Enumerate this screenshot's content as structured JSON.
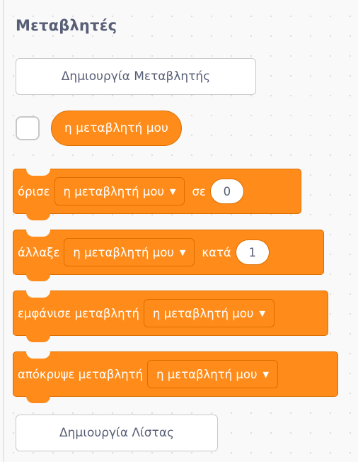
{
  "category": {
    "title": "Μεταβλητές",
    "color": "#ff8c1a",
    "border_color": "#db6e00",
    "text_color": "#575e75"
  },
  "make_variable_button": {
    "label": "Δημιουργία Μεταβλητής"
  },
  "variable_reporter": {
    "checked": false,
    "label": "η μεταβλητή μου"
  },
  "blocks": {
    "set": {
      "label": "όρισε",
      "variable": "η μεταβλητή μου",
      "dropdown_icon": "caret-down-icon",
      "connector": "σε",
      "value": "0"
    },
    "change": {
      "label": "άλλαξε",
      "variable": "η μεταβλητή μου",
      "dropdown_icon": "caret-down-icon",
      "connector": "κατά",
      "value": "1"
    },
    "show": {
      "label": "εμφάνισε μεταβλητή",
      "variable": "η μεταβλητή μου",
      "dropdown_icon": "caret-down-icon"
    },
    "hide": {
      "label": "απόκρυψε μεταβλητή",
      "variable": "η μεταβλητή μου",
      "dropdown_icon": "caret-down-icon"
    }
  },
  "make_list_button": {
    "label": "Δημιουργία Λίστας"
  }
}
